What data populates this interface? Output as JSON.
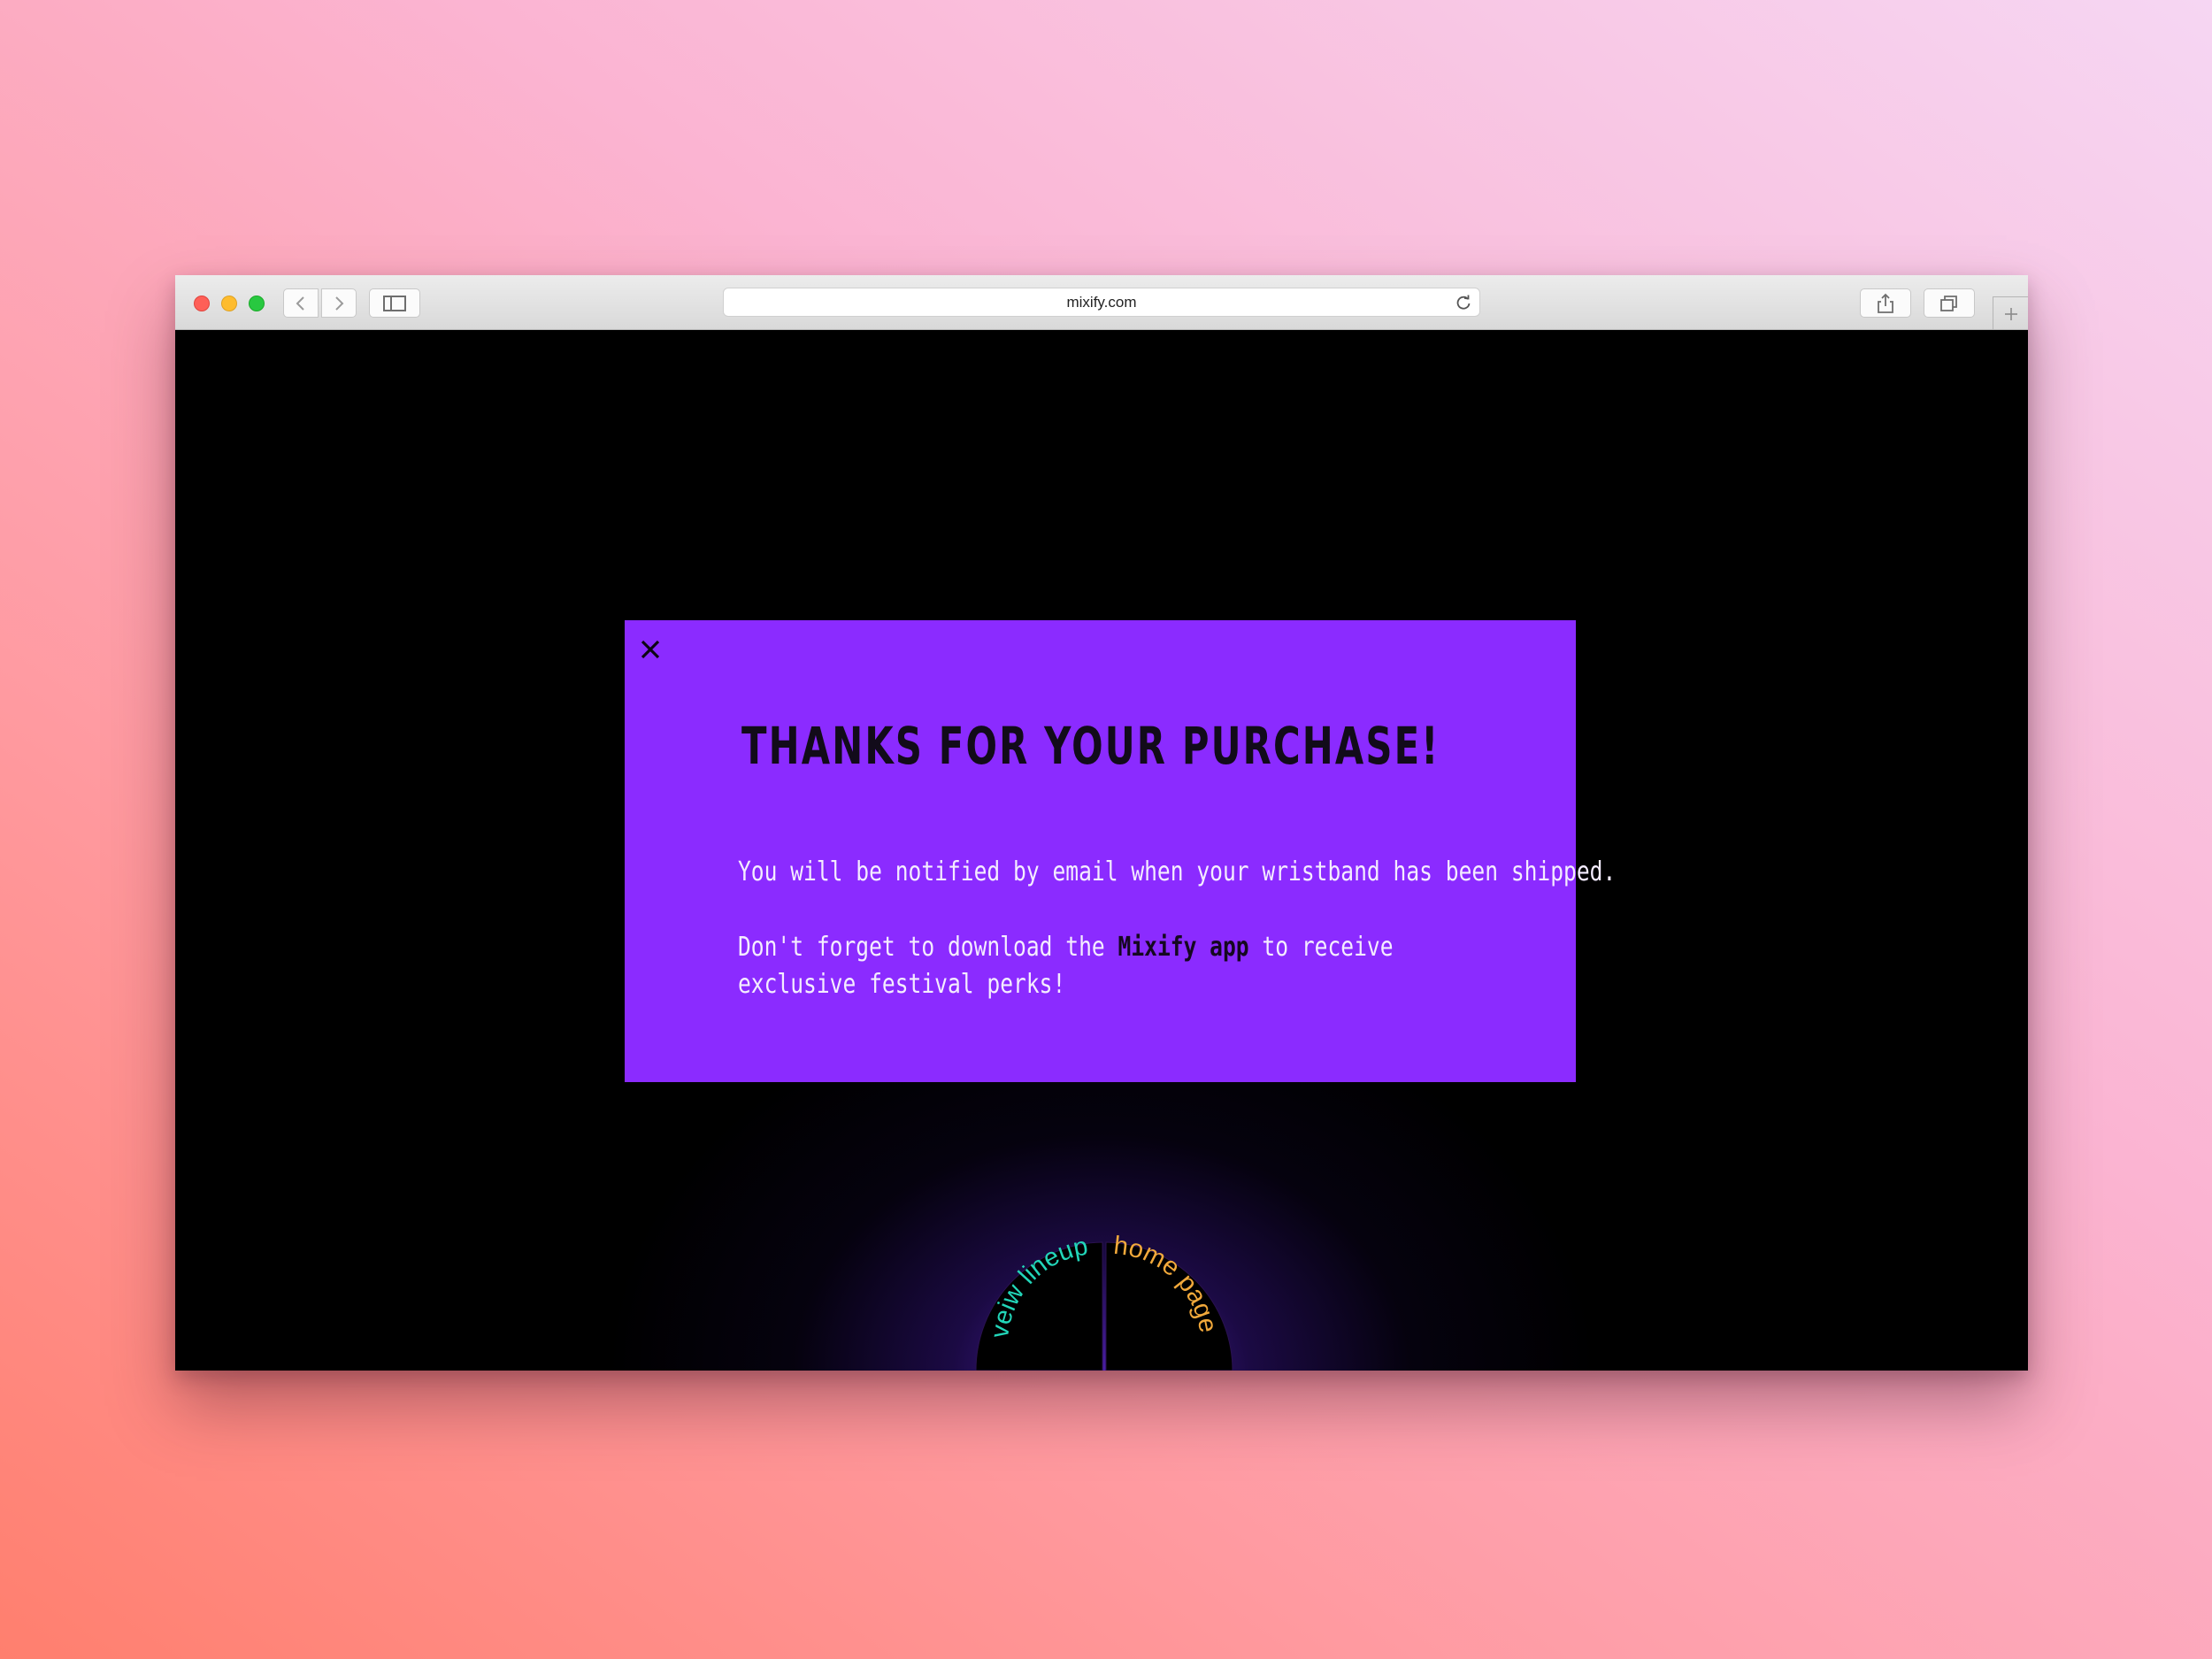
{
  "browser": {
    "url": "mixify.com"
  },
  "modal": {
    "title": "THANKS FOR YOUR PURCHASE!",
    "message_1": "You will be notified by email when your wristband has been shipped.",
    "message_2_prefix": "Don't forget to download the ",
    "message_2_brand": "Mixify app",
    "message_2_suffix": " to receive",
    "message_2_line2": "exclusive festival perks!"
  },
  "nav_wheel": {
    "lineup_label": "veiw lineup",
    "home_label": "home page"
  },
  "colors": {
    "modal_bg": "#8b2bff",
    "page_bg": "#000000",
    "lineup_text": "#22d6b9",
    "home_text": "#f2a93b"
  }
}
